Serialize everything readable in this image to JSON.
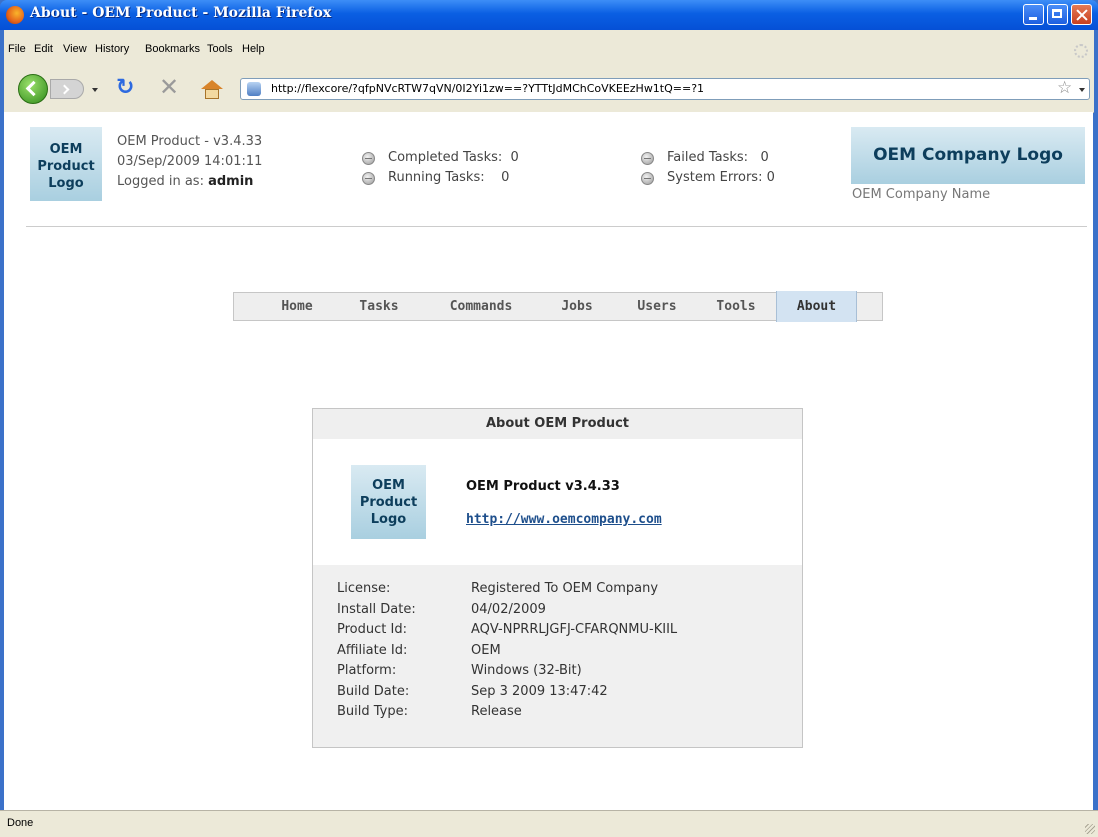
{
  "window": {
    "title": "About - OEM Product - Mozilla Firefox"
  },
  "menu": [
    "File",
    "Edit",
    "View",
    "History",
    "Bookmarks",
    "Tools",
    "Help"
  ],
  "address": {
    "url": "http://flexcore/?qfpNVcRTW7qVN/0I2Yi1zw==?YTTtJdMChCoVKEEzHw1tQ==?1"
  },
  "header": {
    "logo_lines": [
      "OEM",
      "Product",
      "Logo"
    ],
    "product_version": "OEM Product - v3.4.33",
    "datetime": "03/Sep/2009 14:01:11",
    "logged_in_label": "Logged in as: ",
    "user": "admin",
    "status": {
      "completed": "Completed Tasks:  0",
      "running": "Running Tasks:    0",
      "failed": "Failed Tasks:   0",
      "errors": "System Errors: 0"
    },
    "company_logo": "OEM Company Logo",
    "company_name": "OEM Company Name"
  },
  "nav": {
    "tabs": [
      "Home",
      "Tasks",
      "Commands",
      "Jobs",
      "Users",
      "Tools",
      "About"
    ],
    "active": "About"
  },
  "about": {
    "title": "About OEM Product",
    "logo_lines": [
      "OEM",
      "Product",
      "Logo"
    ],
    "product_name": "OEM Product v3.4.33",
    "link": "http://www.oemcompany.com",
    "details": [
      {
        "k": "License:",
        "v": "Registered To OEM Company"
      },
      {
        "k": "Install Date:",
        "v": "04/02/2009"
      },
      {
        "k": "Product Id:",
        "v": "AQV-NPRRLJGFJ-CFARQNMU-KIIL"
      },
      {
        "k": "Affiliate Id:",
        "v": "OEM"
      },
      {
        "k": "Platform:",
        "v": "Windows (32-Bit)"
      },
      {
        "k": "Build Date:",
        "v": "Sep 3 2009 13:47:42"
      },
      {
        "k": "Build Type:",
        "v": "Release"
      }
    ]
  },
  "statusbar": {
    "text": "Done"
  }
}
